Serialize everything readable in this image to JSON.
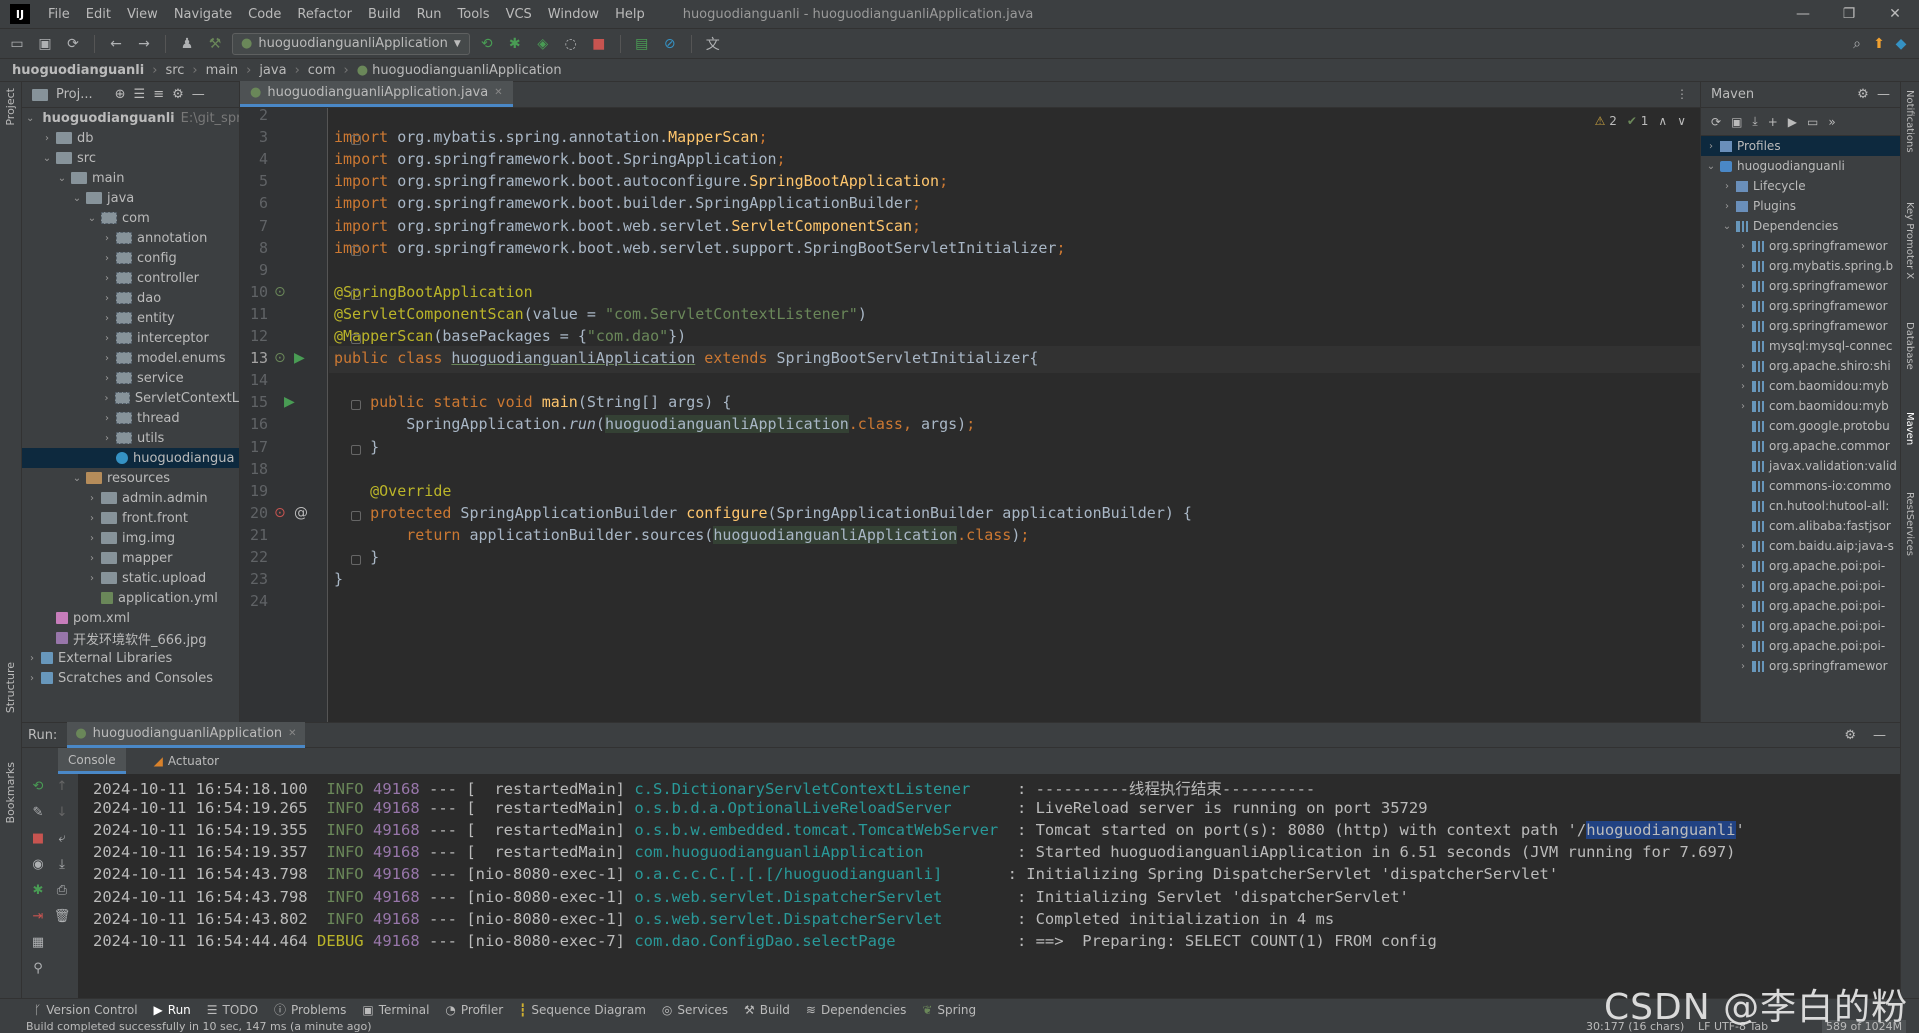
{
  "menubar": {
    "logo": "IJ",
    "items": [
      "File",
      "Edit",
      "View",
      "Navigate",
      "Code",
      "Refactor",
      "Build",
      "Run",
      "Tools",
      "VCS",
      "Window",
      "Help"
    ],
    "title": "huoguodianguanli - huoguodianguanliApplication.java"
  },
  "toolbar": {
    "run_config": "huoguodianguanliApplication"
  },
  "breadcrumb": [
    "huoguodianguanli",
    "src",
    "main",
    "java",
    "com",
    "huoguodianguanliApplication"
  ],
  "project": {
    "title": "Proj...",
    "tree": [
      {
        "label": "huoguodianguanli",
        "extra": "E:\\git_spri",
        "depth": 0,
        "type": "folder",
        "open": true,
        "bold": true
      },
      {
        "label": "db",
        "depth": 1,
        "type": "folder",
        "open": false
      },
      {
        "label": "src",
        "depth": 1,
        "type": "folder",
        "open": true
      },
      {
        "label": "main",
        "depth": 2,
        "type": "folder",
        "open": true
      },
      {
        "label": "java",
        "depth": 3,
        "type": "folder",
        "open": true
      },
      {
        "label": "com",
        "depth": 4,
        "type": "pkg",
        "open": true
      },
      {
        "label": "annotation",
        "depth": 5,
        "type": "pkg",
        "open": false
      },
      {
        "label": "config",
        "depth": 5,
        "type": "pkg",
        "open": false
      },
      {
        "label": "controller",
        "depth": 5,
        "type": "pkg",
        "open": false
      },
      {
        "label": "dao",
        "depth": 5,
        "type": "pkg",
        "open": false
      },
      {
        "label": "entity",
        "depth": 5,
        "type": "pkg",
        "open": false
      },
      {
        "label": "interceptor",
        "depth": 5,
        "type": "pkg",
        "open": false
      },
      {
        "label": "model.enums",
        "depth": 5,
        "type": "pkg",
        "open": false
      },
      {
        "label": "service",
        "depth": 5,
        "type": "pkg",
        "open": false
      },
      {
        "label": "ServletContextL",
        "depth": 5,
        "type": "pkg",
        "open": false
      },
      {
        "label": "thread",
        "depth": 5,
        "type": "pkg",
        "open": false
      },
      {
        "label": "utils",
        "depth": 5,
        "type": "pkg",
        "open": false
      },
      {
        "label": "huoguodiangua",
        "depth": 5,
        "type": "java",
        "leaf": true,
        "selected": true
      },
      {
        "label": "resources",
        "depth": 3,
        "type": "res",
        "open": true
      },
      {
        "label": "admin.admin",
        "depth": 4,
        "type": "folder",
        "open": false
      },
      {
        "label": "front.front",
        "depth": 4,
        "type": "folder",
        "open": false
      },
      {
        "label": "img.img",
        "depth": 4,
        "type": "folder",
        "open": false
      },
      {
        "label": "mapper",
        "depth": 4,
        "type": "folder",
        "open": false
      },
      {
        "label": "static.upload",
        "depth": 4,
        "type": "folder",
        "open": false
      },
      {
        "label": "application.yml",
        "depth": 4,
        "type": "file",
        "leaf": true
      },
      {
        "label": "pom.xml",
        "depth": 1,
        "type": "xml",
        "leaf": true
      },
      {
        "label": "开发环境软件_666.jpg",
        "depth": 1,
        "type": "img",
        "leaf": true
      },
      {
        "label": "External Libraries",
        "depth": 0,
        "type": "lib",
        "open": false
      },
      {
        "label": "Scratches and Consoles",
        "depth": 0,
        "type": "lib",
        "open": false
      }
    ]
  },
  "editor": {
    "tab": "huoguodianguanliApplication.java",
    "inspections": {
      "warnings": "2",
      "ok": "1"
    },
    "lines": [
      {
        "n": "2",
        "html": ""
      },
      {
        "n": "3",
        "html": "<span class='kw'>import</span> org.mybatis.spring.annotation.<span class='fn'>MapperScan</span><span class='kw'>;</span>"
      },
      {
        "n": "4",
        "html": "<span class='kw'>import</span> org.springframework.boot.SpringApplication<span class='kw'>;</span>"
      },
      {
        "n": "5",
        "html": "<span class='kw'>import</span> org.springframework.boot.autoconfigure.<span class='fn'>SpringBootApplication</span><span class='kw'>;</span>"
      },
      {
        "n": "6",
        "html": "<span class='kw'>import</span> org.springframework.boot.builder.SpringApplicationBuilder<span class='kw'>;</span>"
      },
      {
        "n": "7",
        "html": "<span class='kw'>import</span> org.springframework.boot.web.servlet.<span class='fn'>ServletComponentScan</span><span class='kw'>;</span>"
      },
      {
        "n": "8",
        "html": "<span class='kw'>import</span> org.springframework.boot.web.servlet.support.SpringBootServletInitializer<span class='kw'>;</span>"
      },
      {
        "n": "9",
        "html": ""
      },
      {
        "n": "10",
        "html": "<span class='ann'>@SpringBootApplication</span>"
      },
      {
        "n": "11",
        "html": "<span class='ann'>@ServletComponentScan</span>(value = <span class='str'>\"com.ServletContextListener\"</span>)"
      },
      {
        "n": "12",
        "html": "<span class='ann'>@MapperScan</span>(basePackages = {<span class='str'>\"com.dao\"</span>})"
      },
      {
        "n": "13",
        "html": "<span class='kw'>public class</span> <span class='ul'>huoguodianguanliApplication</span> <span class='kw'>extends</span> SpringBootServletInitializer{"
      },
      {
        "n": "14",
        "html": ""
      },
      {
        "n": "15",
        "html": "    <span class='kw'>public static void</span> <span class='fn'>main</span>(String[] args) {"
      },
      {
        "n": "16",
        "html": "        SpringApplication.<span class='it'>run</span>(<span class='hl'>huoguodianguanliApplication</span><span class='kw'>.class,</span> args)<span class='kw'>;</span>"
      },
      {
        "n": "17",
        "html": "    }"
      },
      {
        "n": "18",
        "html": ""
      },
      {
        "n": "19",
        "html": "    <span class='ann'>@Override</span>"
      },
      {
        "n": "20",
        "html": "    <span class='kw'>protected</span> SpringApplicationBuilder <span class='fn'>configure</span>(SpringApplicationBuilder applicationBuilder) {"
      },
      {
        "n": "21",
        "html": "        <span class='kw'>return</span> applicationBuilder.sources(<span class='hl'>huoguodianguanliApplication</span><span class='kw'>.class</span>)<span class='kw'>;</span>"
      },
      {
        "n": "22",
        "html": "    }"
      },
      {
        "n": "23",
        "html": "}"
      },
      {
        "n": "24",
        "html": ""
      }
    ]
  },
  "maven": {
    "title": "Maven",
    "tree": [
      {
        "label": "Profiles",
        "depth": 0,
        "icon": "prof",
        "chev": "›",
        "selected": true
      },
      {
        "label": "huoguodianguanli",
        "depth": 0,
        "icon": "maven",
        "chev": "⌄"
      },
      {
        "label": "Lifecycle",
        "depth": 1,
        "icon": "prof",
        "chev": "›"
      },
      {
        "label": "Plugins",
        "depth": 1,
        "icon": "prof",
        "chev": "›"
      },
      {
        "label": "Dependencies",
        "depth": 1,
        "icon": "dep",
        "chev": "⌄"
      },
      {
        "label": "org.springframewor",
        "depth": 2,
        "icon": "dep",
        "chev": "›"
      },
      {
        "label": "org.mybatis.spring.b",
        "depth": 2,
        "icon": "dep",
        "chev": "›"
      },
      {
        "label": "org.springframewor",
        "depth": 2,
        "icon": "dep",
        "chev": "›"
      },
      {
        "label": "org.springframewor",
        "depth": 2,
        "icon": "dep",
        "chev": "›"
      },
      {
        "label": "org.springframewor",
        "depth": 2,
        "icon": "dep",
        "chev": "›"
      },
      {
        "label": "mysql:mysql-connec",
        "depth": 2,
        "icon": "dep",
        "chev": ""
      },
      {
        "label": "org.apache.shiro:shi",
        "depth": 2,
        "icon": "dep",
        "chev": "›"
      },
      {
        "label": "com.baomidou:myb",
        "depth": 2,
        "icon": "dep",
        "chev": "›"
      },
      {
        "label": "com.baomidou:myb",
        "depth": 2,
        "icon": "dep",
        "chev": "›"
      },
      {
        "label": "com.google.protobu",
        "depth": 2,
        "icon": "dep",
        "chev": ""
      },
      {
        "label": "org.apache.commor",
        "depth": 2,
        "icon": "dep",
        "chev": ""
      },
      {
        "label": "javax.validation:valid",
        "depth": 2,
        "icon": "dep",
        "chev": ""
      },
      {
        "label": "commons-io:commo",
        "depth": 2,
        "icon": "dep",
        "chev": ""
      },
      {
        "label": "cn.hutool:hutool-all:",
        "depth": 2,
        "icon": "dep",
        "chev": ""
      },
      {
        "label": "com.alibaba:fastjsor",
        "depth": 2,
        "icon": "dep",
        "chev": ""
      },
      {
        "label": "com.baidu.aip:java-s",
        "depth": 2,
        "icon": "dep",
        "chev": "›"
      },
      {
        "label": "org.apache.poi:poi-",
        "depth": 2,
        "icon": "dep",
        "chev": "›"
      },
      {
        "label": "org.apache.poi:poi-",
        "depth": 2,
        "icon": "dep",
        "chev": "›"
      },
      {
        "label": "org.apache.poi:poi-",
        "depth": 2,
        "icon": "dep",
        "chev": "›"
      },
      {
        "label": "org.apache.poi:poi-",
        "depth": 2,
        "icon": "dep",
        "chev": "›"
      },
      {
        "label": "org.apache.poi:poi-",
        "depth": 2,
        "icon": "dep",
        "chev": "›"
      },
      {
        "label": "org.springframewor",
        "depth": 2,
        "icon": "dep",
        "chev": "›"
      }
    ]
  },
  "run": {
    "label": "Run:",
    "tab": "huoguodianguanliApplication",
    "subtabs": [
      "Console",
      "Actuator"
    ],
    "log": [
      {
        "ts": "2024-10-11 16:54:18.100",
        "lvl": "INFO",
        "pid": "49168",
        "thread": "[  restartedMain]",
        "logger": "c.S.DictionaryServletContextListener    ",
        "msg": " : ----------线程执行结束----------"
      },
      {
        "ts": "2024-10-11 16:54:19.265",
        "lvl": "INFO",
        "pid": "49168",
        "thread": "[  restartedMain]",
        "logger": "o.s.b.d.a.OptionalLiveReloadServer      ",
        "msg": " : LiveReload server is running on port 35729"
      },
      {
        "ts": "2024-10-11 16:54:19.355",
        "lvl": "INFO",
        "pid": "49168",
        "thread": "[  restartedMain]",
        "logger": "o.s.b.w.embedded.tomcat.TomcatWebServer ",
        "msg": " : Tomcat started on port(s): 8080 (http) with context path '/",
        "sel": "huoguodianguanli",
        "tail": "'"
      },
      {
        "ts": "2024-10-11 16:54:19.357",
        "lvl": "INFO",
        "pid": "49168",
        "thread": "[  restartedMain]",
        "logger": "com.huoguodianguanliApplication         ",
        "msg": " : Started huoguodianguanliApplication in 6.51 seconds (JVM running for 7.697)"
      },
      {
        "ts": "2024-10-11 16:54:43.798",
        "lvl": "INFO",
        "pid": "49168",
        "thread": "[nio-8080-exec-1]",
        "logger": "o.a.c.c.C.[.[.[/huoguodianguanli]      ",
        "msg": " : Initializing Spring DispatcherServlet 'dispatcherServlet'"
      },
      {
        "ts": "2024-10-11 16:54:43.798",
        "lvl": "INFO",
        "pid": "49168",
        "thread": "[nio-8080-exec-1]",
        "logger": "o.s.web.servlet.DispatcherServlet       ",
        "msg": " : Initializing Servlet 'dispatcherServlet'"
      },
      {
        "ts": "2024-10-11 16:54:43.802",
        "lvl": "INFO",
        "pid": "49168",
        "thread": "[nio-8080-exec-1]",
        "logger": "o.s.web.servlet.DispatcherServlet       ",
        "msg": " : Completed initialization in 4 ms"
      },
      {
        "ts": "2024-10-11 16:54:44.464",
        "lvl": "DEBUG",
        "pid": "49168",
        "thread": "[nio-8080-exec-7]",
        "logger": "com.dao.ConfigDao.selectPage            ",
        "msg": " : ==>  Preparing: SELECT COUNT(1) FROM config"
      }
    ]
  },
  "bottom_tools": [
    "Version Control",
    "Run",
    "TODO",
    "Problems",
    "Terminal",
    "Profiler",
    "Sequence Diagram",
    "Services",
    "Build",
    "Dependencies",
    "Spring"
  ],
  "status": {
    "message": "Build completed successfully in 10 sec, 147 ms (a minute ago)",
    "position": "30:177 (16 chars)",
    "encoding": "LF  UTF-8  Tab",
    "memory": "589 of 1024M"
  },
  "left_strip": [
    "Project",
    "Structure",
    "Bookmarks"
  ],
  "right_strip": [
    "Notifications",
    "Key Promoter X",
    "Database",
    "Maven",
    "RestServices"
  ],
  "watermark": "CSDN @李白的粉",
  "colors": {
    "accent": "#4a88c7",
    "keyword": "#cc7832",
    "annotation": "#bbb529",
    "string": "#6a8759"
  }
}
